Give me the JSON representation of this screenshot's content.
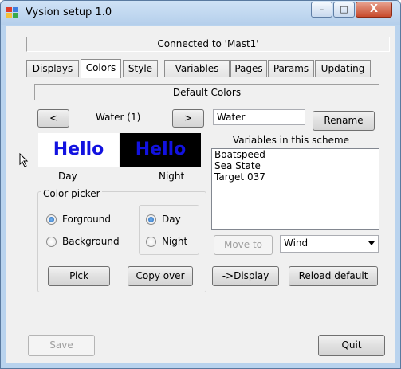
{
  "window": {
    "title": "Vysion setup 1.0",
    "min": "–",
    "max": "□",
    "close": "X"
  },
  "status": "Connected to 'Mast1'",
  "tabs": [
    "Displays",
    "Colors",
    "Style",
    "Variables",
    "Pages",
    "Params",
    "Updating"
  ],
  "section_title": "Default Colors",
  "scheme": {
    "prev": "<",
    "next": ">",
    "label": "Water (1)",
    "name_value": "Water",
    "rename": "Rename"
  },
  "preview": {
    "text": "Hello",
    "day_label": "Day",
    "night_label": "Night"
  },
  "color_picker": {
    "title": "Color picker",
    "target_options": [
      "Forground",
      "Background"
    ],
    "mode_options": [
      "Day",
      "Night"
    ],
    "pick": "Pick",
    "copy_over": "Copy over"
  },
  "variables": {
    "title": "Variables in this scheme",
    "items": [
      "Boatspeed",
      "Sea State",
      "Target 037"
    ],
    "move_to": "Move to",
    "move_target": "Wind",
    "to_display": "->Display",
    "reload_default": "Reload default"
  },
  "footer": {
    "save": "Save",
    "quit": "Quit"
  },
  "colors": {
    "preview_day_bg": "#ffffff",
    "preview_night_bg": "#000000",
    "preview_text": "#1212e0"
  }
}
